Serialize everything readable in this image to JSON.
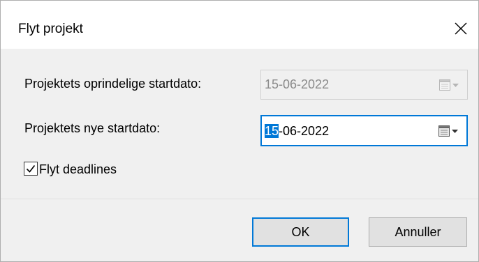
{
  "dialog": {
    "title": "Flyt projekt",
    "close_icon": "close-icon"
  },
  "form": {
    "original_start_label": "Projektets oprindelige startdato:",
    "original_start_value": "15-06-2022",
    "new_start_label": "Projektets nye startdato:",
    "new_start_value_selected": "15",
    "new_start_value_rest": "-06-2022",
    "calendar_icon": "calendar-dropdown-icon",
    "move_deadlines_label": "Flyt deadlines",
    "move_deadlines_checked": true
  },
  "buttons": {
    "ok_label": "OK",
    "cancel_label": "Annuller"
  },
  "colors": {
    "accent": "#0078d7",
    "dialog_bg": "#f0f0f0",
    "button_bg": "#e1e1e1",
    "disabled_text": "#8a8a8a"
  }
}
